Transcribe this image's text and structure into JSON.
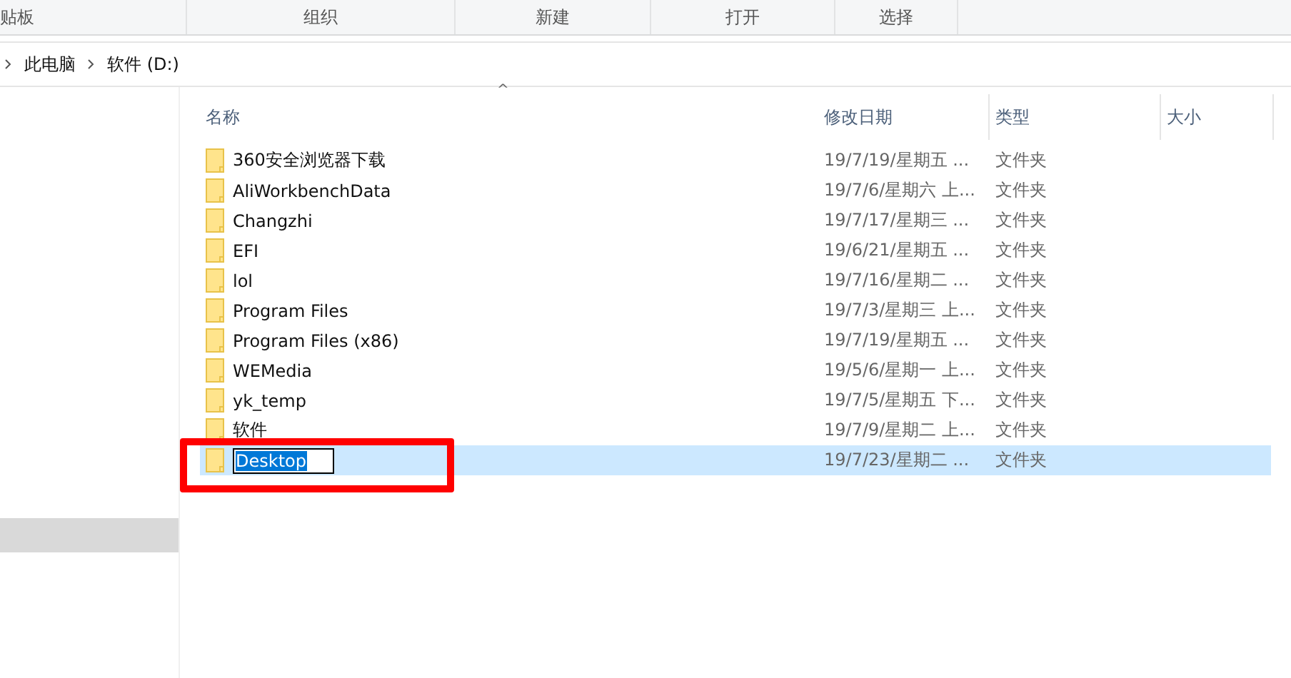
{
  "ribbon": {
    "groups": [
      "贴板",
      "组织",
      "新建",
      "打开",
      "选择"
    ]
  },
  "breadcrumb": [
    "此电脑",
    "软件 (D:)"
  ],
  "sidebar": {
    "items": [
      {
        "selected": true
      }
    ]
  },
  "table": {
    "sort_arrow": "^",
    "columns": [
      "名称",
      "修改日期",
      "类型",
      "大小"
    ],
    "rows": [
      {
        "name": "360安全浏览器下载",
        "date": "19/7/19/星期五 ...",
        "type": "文件夹",
        "selected": false,
        "editing": false
      },
      {
        "name": "AliWorkbenchData",
        "date": "19/7/6/星期六 上...",
        "type": "文件夹",
        "selected": false,
        "editing": false
      },
      {
        "name": "Changzhi",
        "date": "19/7/17/星期三 ...",
        "type": "文件夹",
        "selected": false,
        "editing": false
      },
      {
        "name": "EFI",
        "date": "19/6/21/星期五 ...",
        "type": "文件夹",
        "selected": false,
        "editing": false
      },
      {
        "name": "lol",
        "date": "19/7/16/星期二 ...",
        "type": "文件夹",
        "selected": false,
        "editing": false
      },
      {
        "name": "Program Files",
        "date": "19/7/3/星期三 上...",
        "type": "文件夹",
        "selected": false,
        "editing": false
      },
      {
        "name": "Program Files (x86)",
        "date": "19/7/19/星期五 ...",
        "type": "文件夹",
        "selected": false,
        "editing": false
      },
      {
        "name": "WEMedia",
        "date": "19/5/6/星期一 上...",
        "type": "文件夹",
        "selected": false,
        "editing": false
      },
      {
        "name": "yk_temp",
        "date": "19/7/5/星期五 下...",
        "type": "文件夹",
        "selected": false,
        "editing": false
      },
      {
        "name": "软件",
        "date": "19/7/9/星期二 上...",
        "type": "文件夹",
        "selected": false,
        "editing": false
      },
      {
        "name": "Desktop",
        "date": "19/7/23/星期二 ...",
        "type": "文件夹",
        "selected": true,
        "editing": true
      }
    ]
  }
}
